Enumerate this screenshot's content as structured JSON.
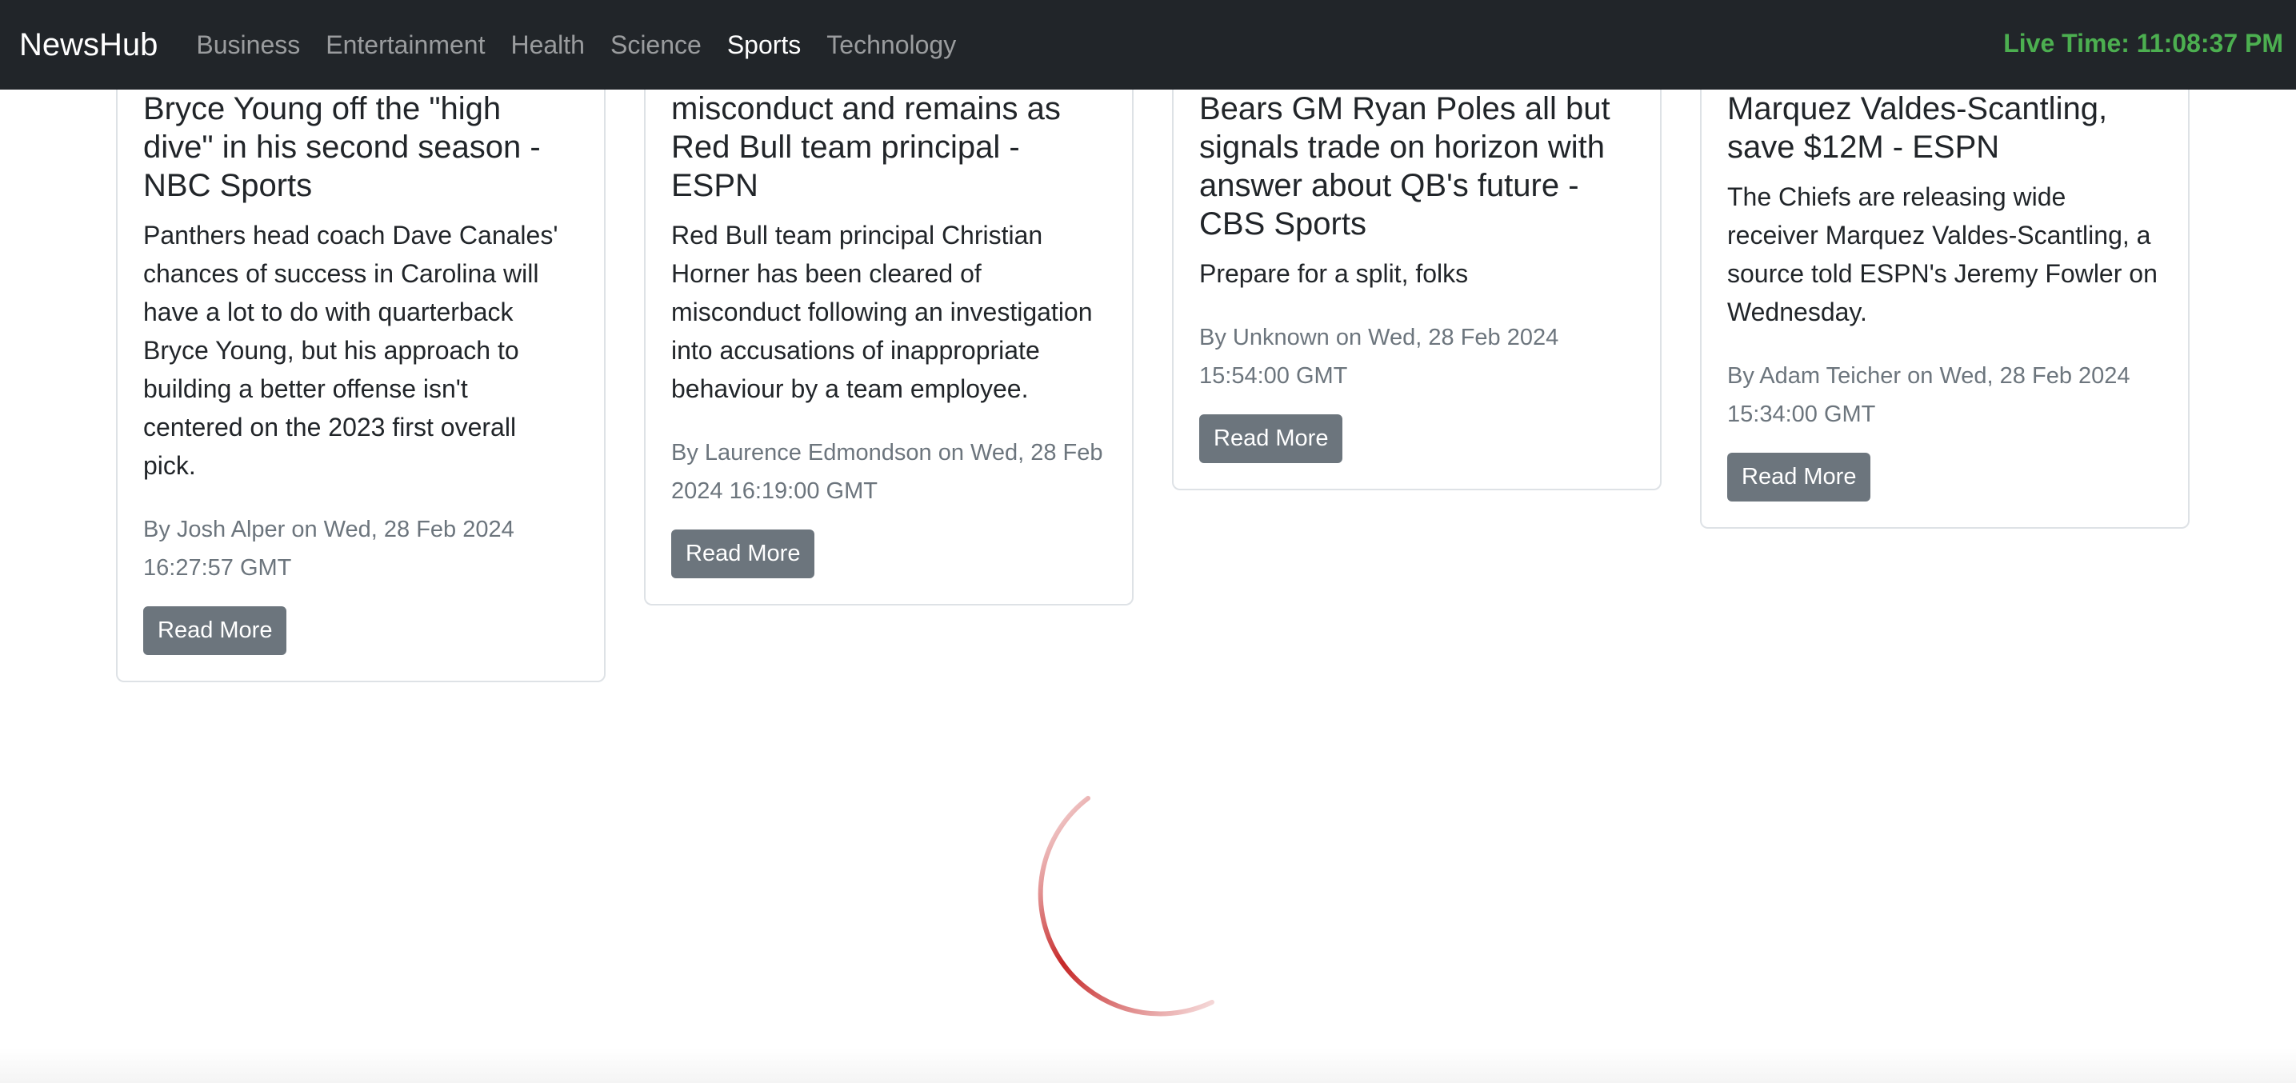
{
  "navbar": {
    "brand": "NewsHub",
    "links": [
      "Business",
      "Entertainment",
      "Health",
      "Science",
      "Sports",
      "Technology"
    ],
    "active": "Sports",
    "live_time": "Live Time: 11:08:37 PM"
  },
  "articles": [
    {
      "title_lines": [
        "Bryce Young off the \"high",
        "dive\" in his second season -",
        "NBC Sports"
      ],
      "desc_lines": [
        "Panthers head coach Dave Canales'",
        "chances of success in Carolina will",
        "have a lot to do with quarterback",
        "Bryce Young, but his approach to",
        "building a better offense isn't",
        "centered on the 2023 first overall",
        "pick."
      ],
      "meta_lines": [
        "By Josh Alper on Wed, 28 Feb 2024",
        "16:27:57 GMT"
      ],
      "button": "Read More"
    },
    {
      "title_lines": [
        "misconduct and remains as",
        "Red Bull team principal -",
        "ESPN"
      ],
      "desc_lines": [
        "Red Bull team principal Christian",
        "Horner has been cleared of",
        "misconduct following an investigation",
        "into accusations of inappropriate",
        "behaviour by a team employee."
      ],
      "meta_lines": [
        "By Laurence Edmondson on Wed, 28 Feb",
        "2024 16:19:00 GMT"
      ],
      "button": "Read More"
    },
    {
      "title_lines": [
        "Bears GM Ryan Poles all but",
        "signals trade on horizon with",
        "answer about QB's future -",
        "CBS Sports"
      ],
      "desc_lines": [
        "Prepare for a split, folks"
      ],
      "meta_lines": [
        "By Unknown on Wed, 28 Feb 2024",
        "15:54:00 GMT"
      ],
      "button": "Read More"
    },
    {
      "title_lines": [
        "Marquez Valdes-Scantling,",
        "save $12M - ESPN"
      ],
      "desc_lines": [
        "The Chiefs are releasing wide",
        "receiver Marquez Valdes-Scantling, a",
        "source told ESPN's Jeremy Fowler on",
        "Wednesday."
      ],
      "meta_lines": [
        "By Adam Teicher on Wed, 28 Feb 2024",
        "15:34:00 GMT"
      ],
      "button": "Read More"
    }
  ],
  "colors": {
    "navbar_bg": "#212529",
    "live_time": "#4caf50",
    "button_bg": "#6c757d",
    "spinner": "#c62828"
  },
  "icons": {
    "loading": "loading-spinner-icon"
  }
}
